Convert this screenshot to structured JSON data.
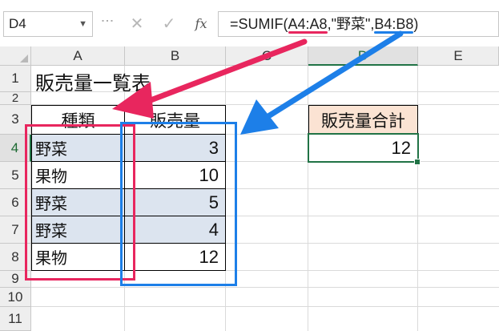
{
  "formula_bar": {
    "name_box": "D4",
    "cancel_symbol": "✕",
    "enter_symbol": "✓",
    "fx_symbol": "fx",
    "formula_prefix": "=SUMIF(",
    "formula_range": "A4:A8",
    "formula_mid": ",\"野菜\",",
    "formula_sum_range": "B4:B8",
    "formula_suffix": ")"
  },
  "columns": [
    "A",
    "B",
    "C",
    "D",
    "E"
  ],
  "rows": [
    "1",
    "2",
    "3",
    "4",
    "5",
    "6",
    "7",
    "8",
    "9",
    "10",
    "11"
  ],
  "sheet": {
    "title": "販売量一覧表",
    "table_headers": [
      "種類",
      "販売量"
    ],
    "table_rows": [
      {
        "type": "野菜",
        "amount": "3"
      },
      {
        "type": "果物",
        "amount": "10"
      },
      {
        "type": "野菜",
        "amount": "5"
      },
      {
        "type": "野菜",
        "amount": "4"
      },
      {
        "type": "果物",
        "amount": "12"
      }
    ],
    "total_label": "販売量合計",
    "total_value": "12"
  },
  "colors": {
    "accent_red": "#e8265e",
    "accent_blue": "#1d7fe8",
    "selection_green": "#217346",
    "shaded_row": "#dce4ef",
    "total_header_bg": "#fbe3d3"
  }
}
